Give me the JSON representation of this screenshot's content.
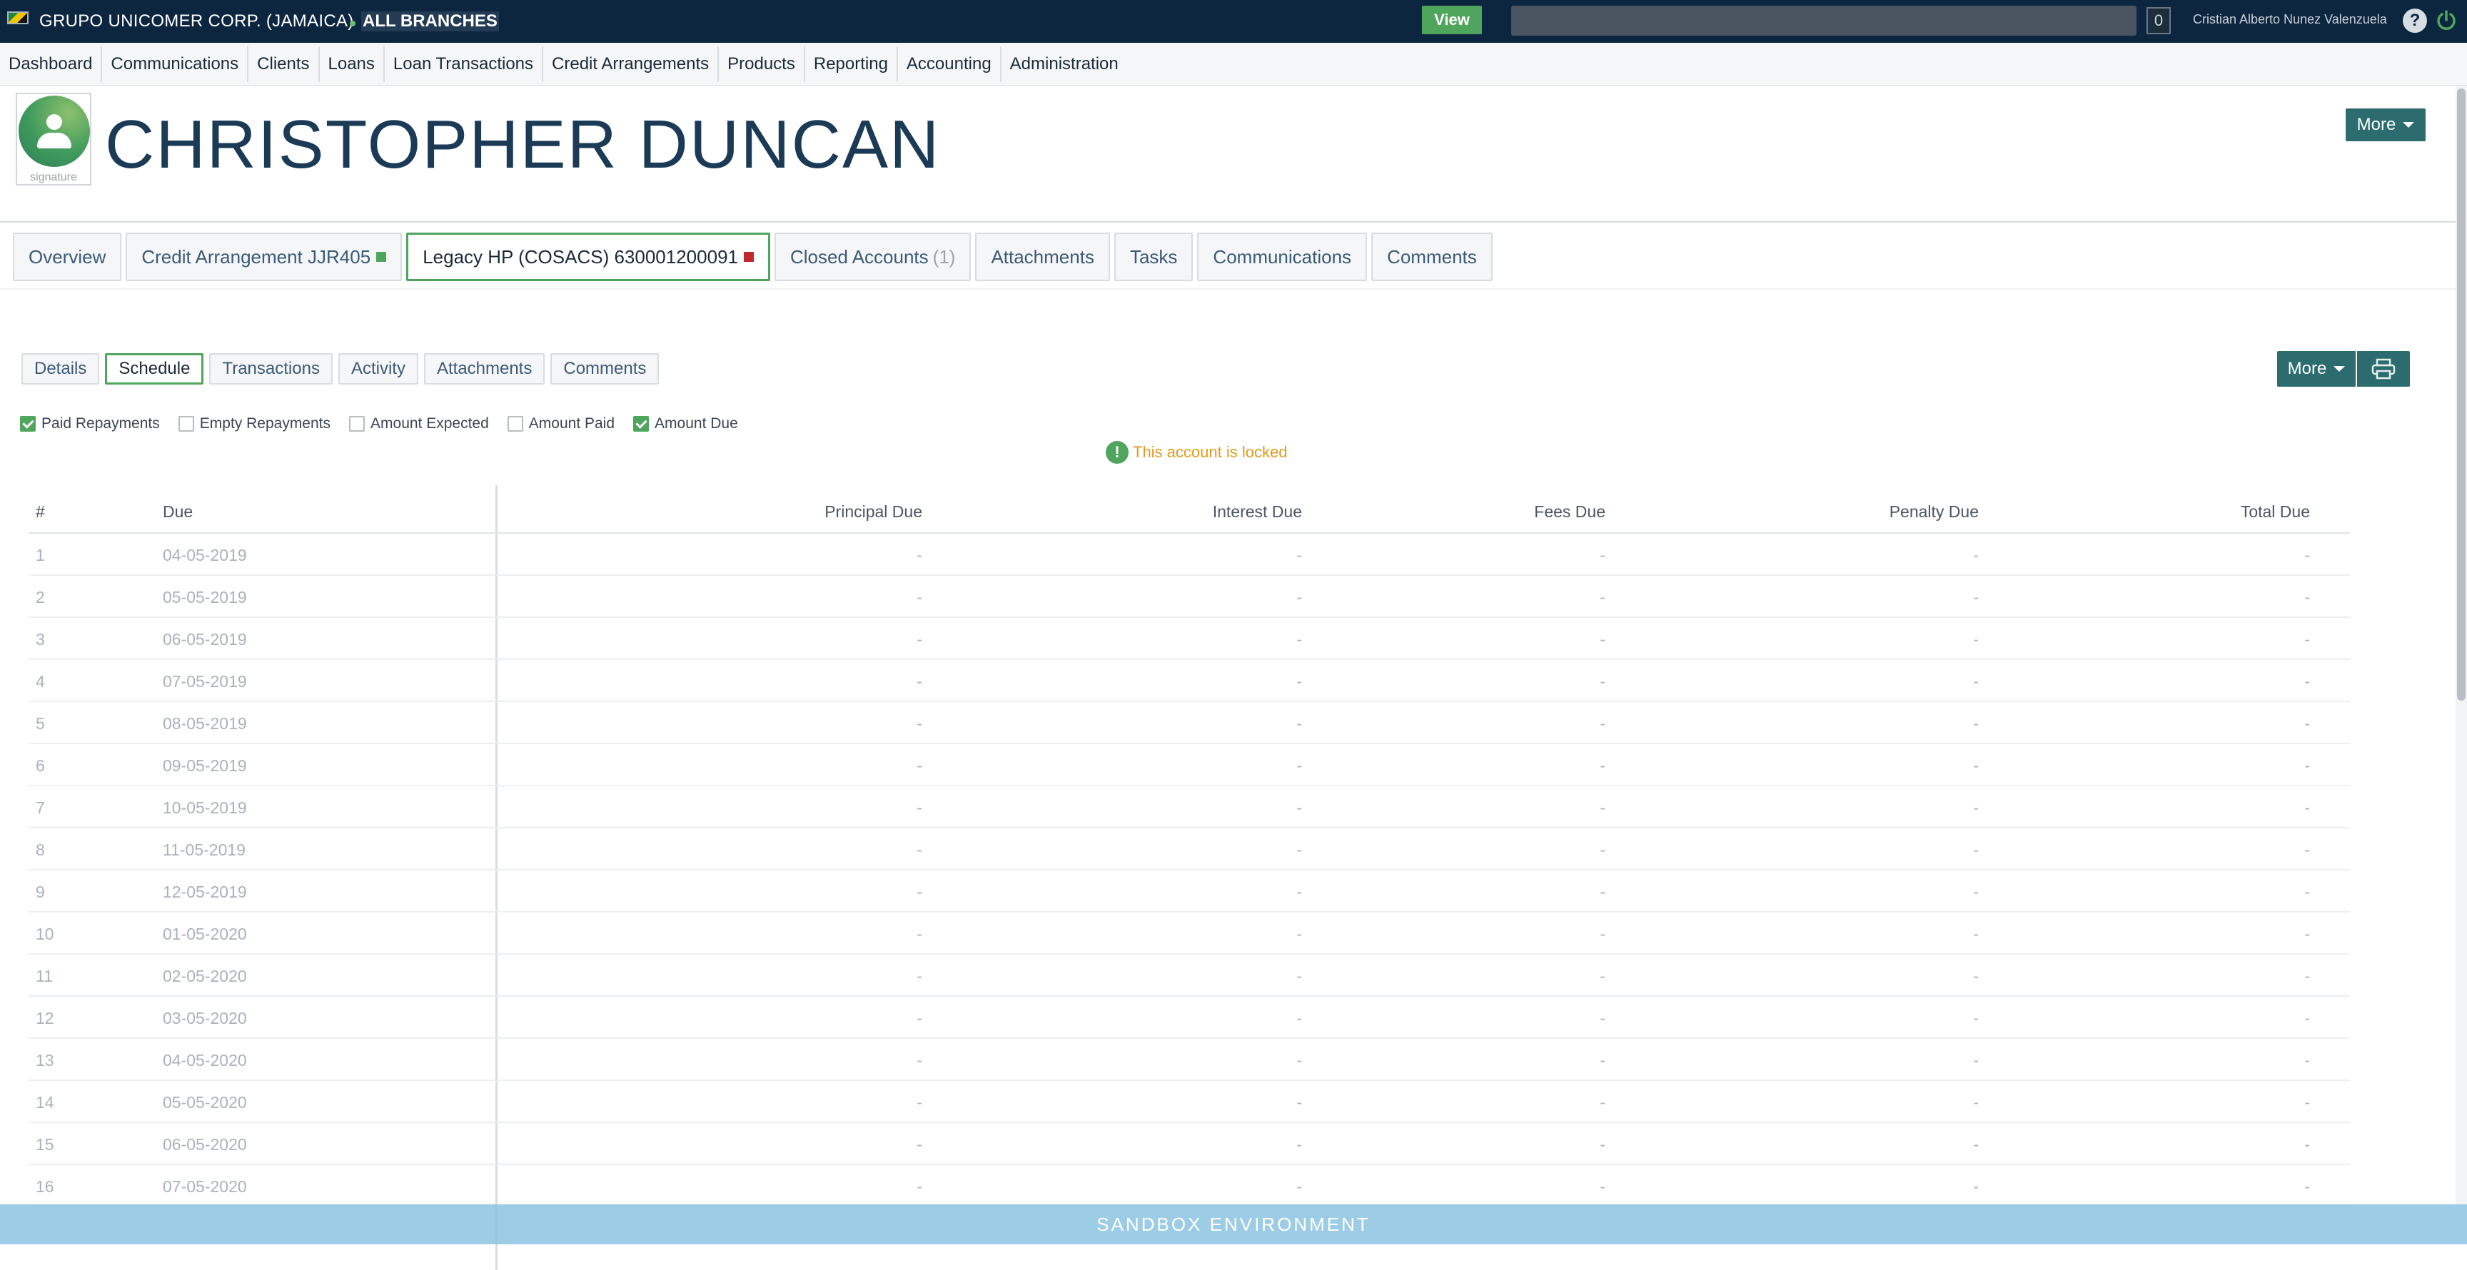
{
  "topbar": {
    "org_name": "GRUPO UNICOMER CORP. (JAMAICA)",
    "branch_label": "ALL BRANCHES",
    "view_button": "View",
    "search_value": "",
    "counter": "0",
    "user_name": "Cristian Alberto Nunez Valenzuela",
    "help_icon": "?"
  },
  "nav": {
    "items": [
      "Dashboard",
      "Communications",
      "Clients",
      "Loans",
      "Loan Transactions",
      "Credit Arrangements",
      "Products",
      "Reporting",
      "Accounting",
      "Administration"
    ]
  },
  "header": {
    "avatar_caption": "signature",
    "client_name": "CHRISTOPHER DUNCAN",
    "more_label": "More"
  },
  "account_tabs": [
    {
      "label": "Overview"
    },
    {
      "label": "Credit Arrangement JJR405",
      "indicator": "green"
    },
    {
      "label": "Legacy HP (COSACS) 630001200091",
      "indicator": "red",
      "active": true
    },
    {
      "label": "Closed Accounts",
      "count": "(1)"
    },
    {
      "label": "Attachments"
    },
    {
      "label": "Tasks"
    },
    {
      "label": "Communications"
    },
    {
      "label": "Comments"
    }
  ],
  "sub_tabs": {
    "items": [
      "Details",
      "Schedule",
      "Transactions",
      "Activity",
      "Attachments",
      "Comments"
    ],
    "active": "Schedule",
    "more_label": "More"
  },
  "filters": [
    {
      "label": "Paid Repayments",
      "checked": true
    },
    {
      "label": "Empty Repayments",
      "checked": false
    },
    {
      "label": "Amount Expected",
      "checked": false
    },
    {
      "label": "Amount Paid",
      "checked": false
    },
    {
      "label": "Amount Due",
      "checked": true
    }
  ],
  "notice": {
    "icon": "!",
    "text": "This account is locked"
  },
  "schedule": {
    "columns": {
      "num": "#",
      "due": "Due",
      "principal": "Principal Due",
      "interest": "Interest Due",
      "fees": "Fees Due",
      "penalty": "Penalty Due",
      "total": "Total Due"
    },
    "rows": [
      {
        "num": "1",
        "due": "04-05-2019",
        "principal": "-",
        "interest": "-",
        "fees": "-",
        "penalty": "-",
        "total": "-"
      },
      {
        "num": "2",
        "due": "05-05-2019",
        "principal": "-",
        "interest": "-",
        "fees": "-",
        "penalty": "-",
        "total": "-"
      },
      {
        "num": "3",
        "due": "06-05-2019",
        "principal": "-",
        "interest": "-",
        "fees": "-",
        "penalty": "-",
        "total": "-"
      },
      {
        "num": "4",
        "due": "07-05-2019",
        "principal": "-",
        "interest": "-",
        "fees": "-",
        "penalty": "-",
        "total": "-"
      },
      {
        "num": "5",
        "due": "08-05-2019",
        "principal": "-",
        "interest": "-",
        "fees": "-",
        "penalty": "-",
        "total": "-"
      },
      {
        "num": "6",
        "due": "09-05-2019",
        "principal": "-",
        "interest": "-",
        "fees": "-",
        "penalty": "-",
        "total": "-"
      },
      {
        "num": "7",
        "due": "10-05-2019",
        "principal": "-",
        "interest": "-",
        "fees": "-",
        "penalty": "-",
        "total": "-"
      },
      {
        "num": "8",
        "due": "11-05-2019",
        "principal": "-",
        "interest": "-",
        "fees": "-",
        "penalty": "-",
        "total": "-"
      },
      {
        "num": "9",
        "due": "12-05-2019",
        "principal": "-",
        "interest": "-",
        "fees": "-",
        "penalty": "-",
        "total": "-"
      },
      {
        "num": "10",
        "due": "01-05-2020",
        "principal": "-",
        "interest": "-",
        "fees": "-",
        "penalty": "-",
        "total": "-"
      },
      {
        "num": "11",
        "due": "02-05-2020",
        "principal": "-",
        "interest": "-",
        "fees": "-",
        "penalty": "-",
        "total": "-"
      },
      {
        "num": "12",
        "due": "03-05-2020",
        "principal": "-",
        "interest": "-",
        "fees": "-",
        "penalty": "-",
        "total": "-"
      },
      {
        "num": "13",
        "due": "04-05-2020",
        "principal": "-",
        "interest": "-",
        "fees": "-",
        "penalty": "-",
        "total": "-"
      },
      {
        "num": "14",
        "due": "05-05-2020",
        "principal": "-",
        "interest": "-",
        "fees": "-",
        "penalty": "-",
        "total": "-"
      },
      {
        "num": "15",
        "due": "06-05-2020",
        "principal": "-",
        "interest": "-",
        "fees": "-",
        "penalty": "-",
        "total": "-"
      },
      {
        "num": "16",
        "due": "07-05-2020",
        "principal": "-",
        "interest": "-",
        "fees": "-",
        "penalty": "-",
        "total": "-"
      }
    ]
  },
  "banner": {
    "text": "SANDBOX ENVIRONMENT"
  },
  "colors": {
    "topbar_bg": "#0d2640",
    "accent_green": "#4ea55b",
    "button_teal": "#2c6b6e",
    "locked_text": "#e39a1a",
    "indicator_red": "#c0282e"
  },
  "icons": [
    "flag-icon",
    "help-icon",
    "power-icon",
    "caret-down-icon",
    "print-icon",
    "checkbox-icon",
    "alert-icon",
    "user-avatar-icon"
  ]
}
